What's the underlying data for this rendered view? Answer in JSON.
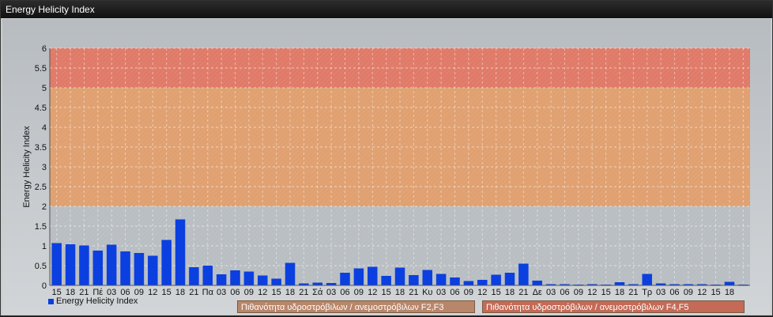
{
  "window": {
    "title": "Energy Helicity Index"
  },
  "legend": {
    "series_label": "Energy Helicity Index"
  },
  "bands": [
    {
      "label": "Πιθανότητα υδροστρόβιλων / ανεμοστρόβιλων F2,F3",
      "from": 2,
      "to": 5,
      "color": "#e0a070"
    },
    {
      "label": "Πιθανότητα υδροστρόβιλων / ανεμοστρόβιλων F4,F5",
      "from": 5,
      "to": 6,
      "color": "#e07a68"
    }
  ],
  "chart_data": {
    "type": "bar",
    "ylabel": "Energy Helicity Index",
    "ylim": [
      0,
      6
    ],
    "yticks": [
      "0",
      "0.5",
      "1",
      "1.5",
      "2",
      "2.5",
      "3",
      "3.5",
      "4",
      "4.5",
      "5",
      "5.5",
      "6"
    ],
    "grid": true,
    "categories": [
      "15",
      "18",
      "21",
      "Πέ",
      "03",
      "06",
      "09",
      "12",
      "15",
      "18",
      "21",
      "Πα",
      "03",
      "06",
      "09",
      "12",
      "15",
      "18",
      "21",
      "Σά",
      "03",
      "06",
      "09",
      "12",
      "15",
      "18",
      "21",
      "Κυ",
      "03",
      "06",
      "09",
      "12",
      "15",
      "18",
      "21",
      "Δε",
      "03",
      "06",
      "09",
      "12",
      "15",
      "18",
      "21",
      "Τρ",
      "03",
      "06",
      "09",
      "12",
      "15",
      "18",
      ""
    ],
    "series": [
      {
        "name": "Energy Helicity Index",
        "color": "#0b3fe0",
        "values": [
          1.07,
          1.04,
          1.01,
          0.88,
          1.03,
          0.86,
          0.82,
          0.75,
          1.15,
          1.67,
          0.46,
          0.5,
          0.28,
          0.38,
          0.35,
          0.25,
          0.17,
          0.57,
          0.05,
          0.07,
          0.06,
          0.32,
          0.43,
          0.47,
          0.24,
          0.45,
          0.26,
          0.39,
          0.29,
          0.2,
          0.11,
          0.14,
          0.27,
          0.32,
          0.55,
          0.12,
          0.03,
          0.03,
          0.02,
          0.03,
          0.02,
          0.08,
          0.03,
          0.29,
          0.05,
          0.03,
          0.03,
          0.03,
          0.02,
          0.09,
          0.02
        ]
      }
    ]
  }
}
